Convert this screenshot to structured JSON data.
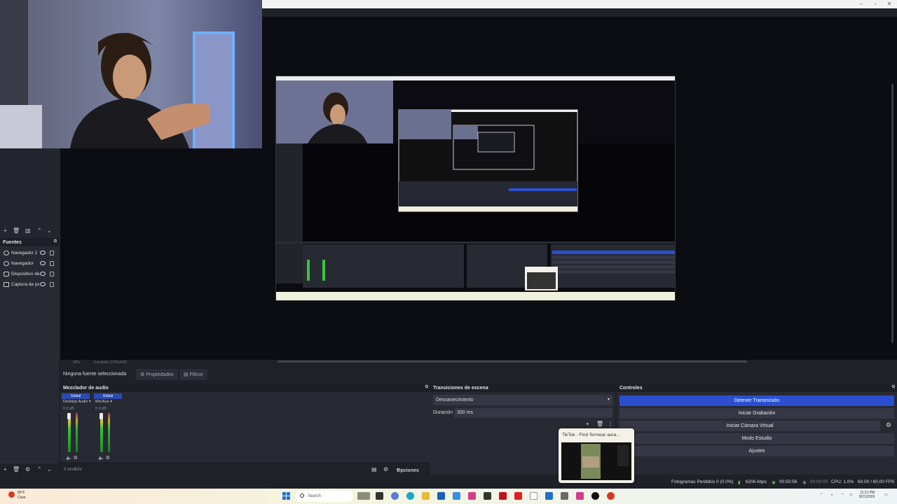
{
  "titlebar": {
    "min": "–",
    "max": "▫",
    "close": "✕"
  },
  "preview": {
    "zoom": "59%",
    "scale_label": "Escalado (1741x642)"
  },
  "properties_bar": {
    "no_selection": "Ninguna fuente seleccionada",
    "properties": "Propiedades",
    "filters": "Filtros"
  },
  "sources": {
    "title": "Fuentes",
    "items": [
      {
        "label": "Navegador 2",
        "icon": "globe-icon"
      },
      {
        "label": "Navegador",
        "icon": "globe-icon"
      },
      {
        "label": "Dispositivo de captura",
        "icon": "camera-icon"
      },
      {
        "label": "Captura de pantalla",
        "icon": "monitor-icon"
      }
    ]
  },
  "mixer": {
    "title": "Mezclador de audio",
    "strips": [
      {
        "global": "Global",
        "name": "Desktop Audio",
        "db": "0.0 dB"
      },
      {
        "global": "Global",
        "name": "Mic/Aux",
        "db": "0.0 dB"
      }
    ],
    "scale": [
      "0",
      "-6",
      "-12",
      "-18",
      "-24",
      "-30",
      "-36",
      "-42",
      "-48",
      "-54",
      "-60"
    ],
    "hidden_count": "0 oculto/s",
    "options": "Opciones"
  },
  "transitions": {
    "title": "Transiciones de escena",
    "selected": "Desvanecimiento",
    "duration_label": "Duración",
    "duration_value": "300 ms"
  },
  "controls": {
    "title": "Controles",
    "stop_stream": "Detener Transmisión",
    "start_recording": "Iniciar Grabación",
    "start_virtual_cam": "Iniciar Cámara Virtual",
    "studio_mode": "Modo Estudio",
    "settings": "Ajustes"
  },
  "status": {
    "dropped_frames": "Fotogramas Perdidos 0 (0.0%)",
    "bitrate": "6206 kbps",
    "stream_time": "00:50:56",
    "rec_time": "00:00:00",
    "cpu": "CPU: 1.0%",
    "fps": "60.00 / 60.00 FPS"
  },
  "popup": {
    "title": "TikTok - Find 'formear aura..."
  },
  "taskbar": {
    "weather_temp": "80°F",
    "weather_desc": "Clear",
    "search_placeholder": "Search",
    "time": "11:21 PM",
    "date": "8/21/2026"
  },
  "colors": {
    "accent": "#2c4fd1",
    "panel": "#272a33",
    "canvas": "#0c0d13"
  }
}
